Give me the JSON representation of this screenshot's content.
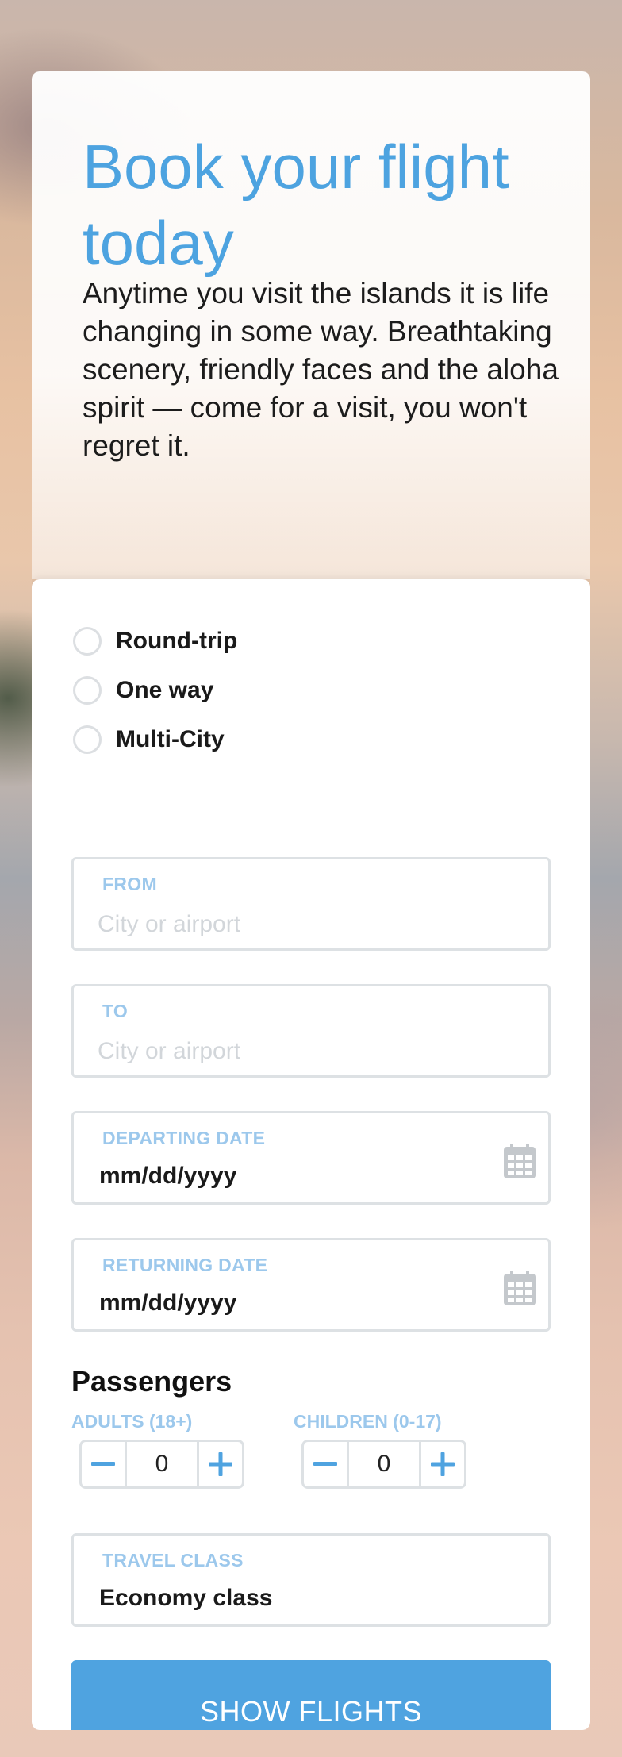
{
  "hero": {
    "title": "Book your flight today",
    "description": "Anytime you visit the islands it is life changing in some way. Breathtaking scenery, friendly faces and the aloha spirit — come for a visit, you won't regret it."
  },
  "trip_type": {
    "options": [
      "Round-trip",
      "One way",
      "Multi-City"
    ],
    "selected": null
  },
  "from": {
    "label": "FROM",
    "placeholder": "City or airport",
    "value": ""
  },
  "to": {
    "label": "TO",
    "placeholder": "City or airport",
    "value": ""
  },
  "departing": {
    "label": "DEPARTING DATE",
    "value": "mm/dd/yyyy",
    "icon": "calendar-icon"
  },
  "returning": {
    "label": "RETURNING DATE",
    "value": "mm/dd/yyyy",
    "icon": "calendar-icon"
  },
  "passengers": {
    "title": "Passengers",
    "adults": {
      "label": "ADULTS (18+)",
      "value": "0",
      "decrement_icon": "minus-icon",
      "increment_icon": "plus-icon"
    },
    "children": {
      "label": "CHILDREN (0-17)",
      "value": "0",
      "decrement_icon": "minus-icon",
      "increment_icon": "plus-icon"
    }
  },
  "travel_class": {
    "label": "TRAVEL CLASS",
    "value": "Economy class"
  },
  "submit": {
    "label": "SHOW FLIGHTS"
  },
  "colors": {
    "accent": "#4fa3e0",
    "label": "#9cc8ec",
    "border": "#dde1e4",
    "placeholder": "#d2d6da"
  }
}
